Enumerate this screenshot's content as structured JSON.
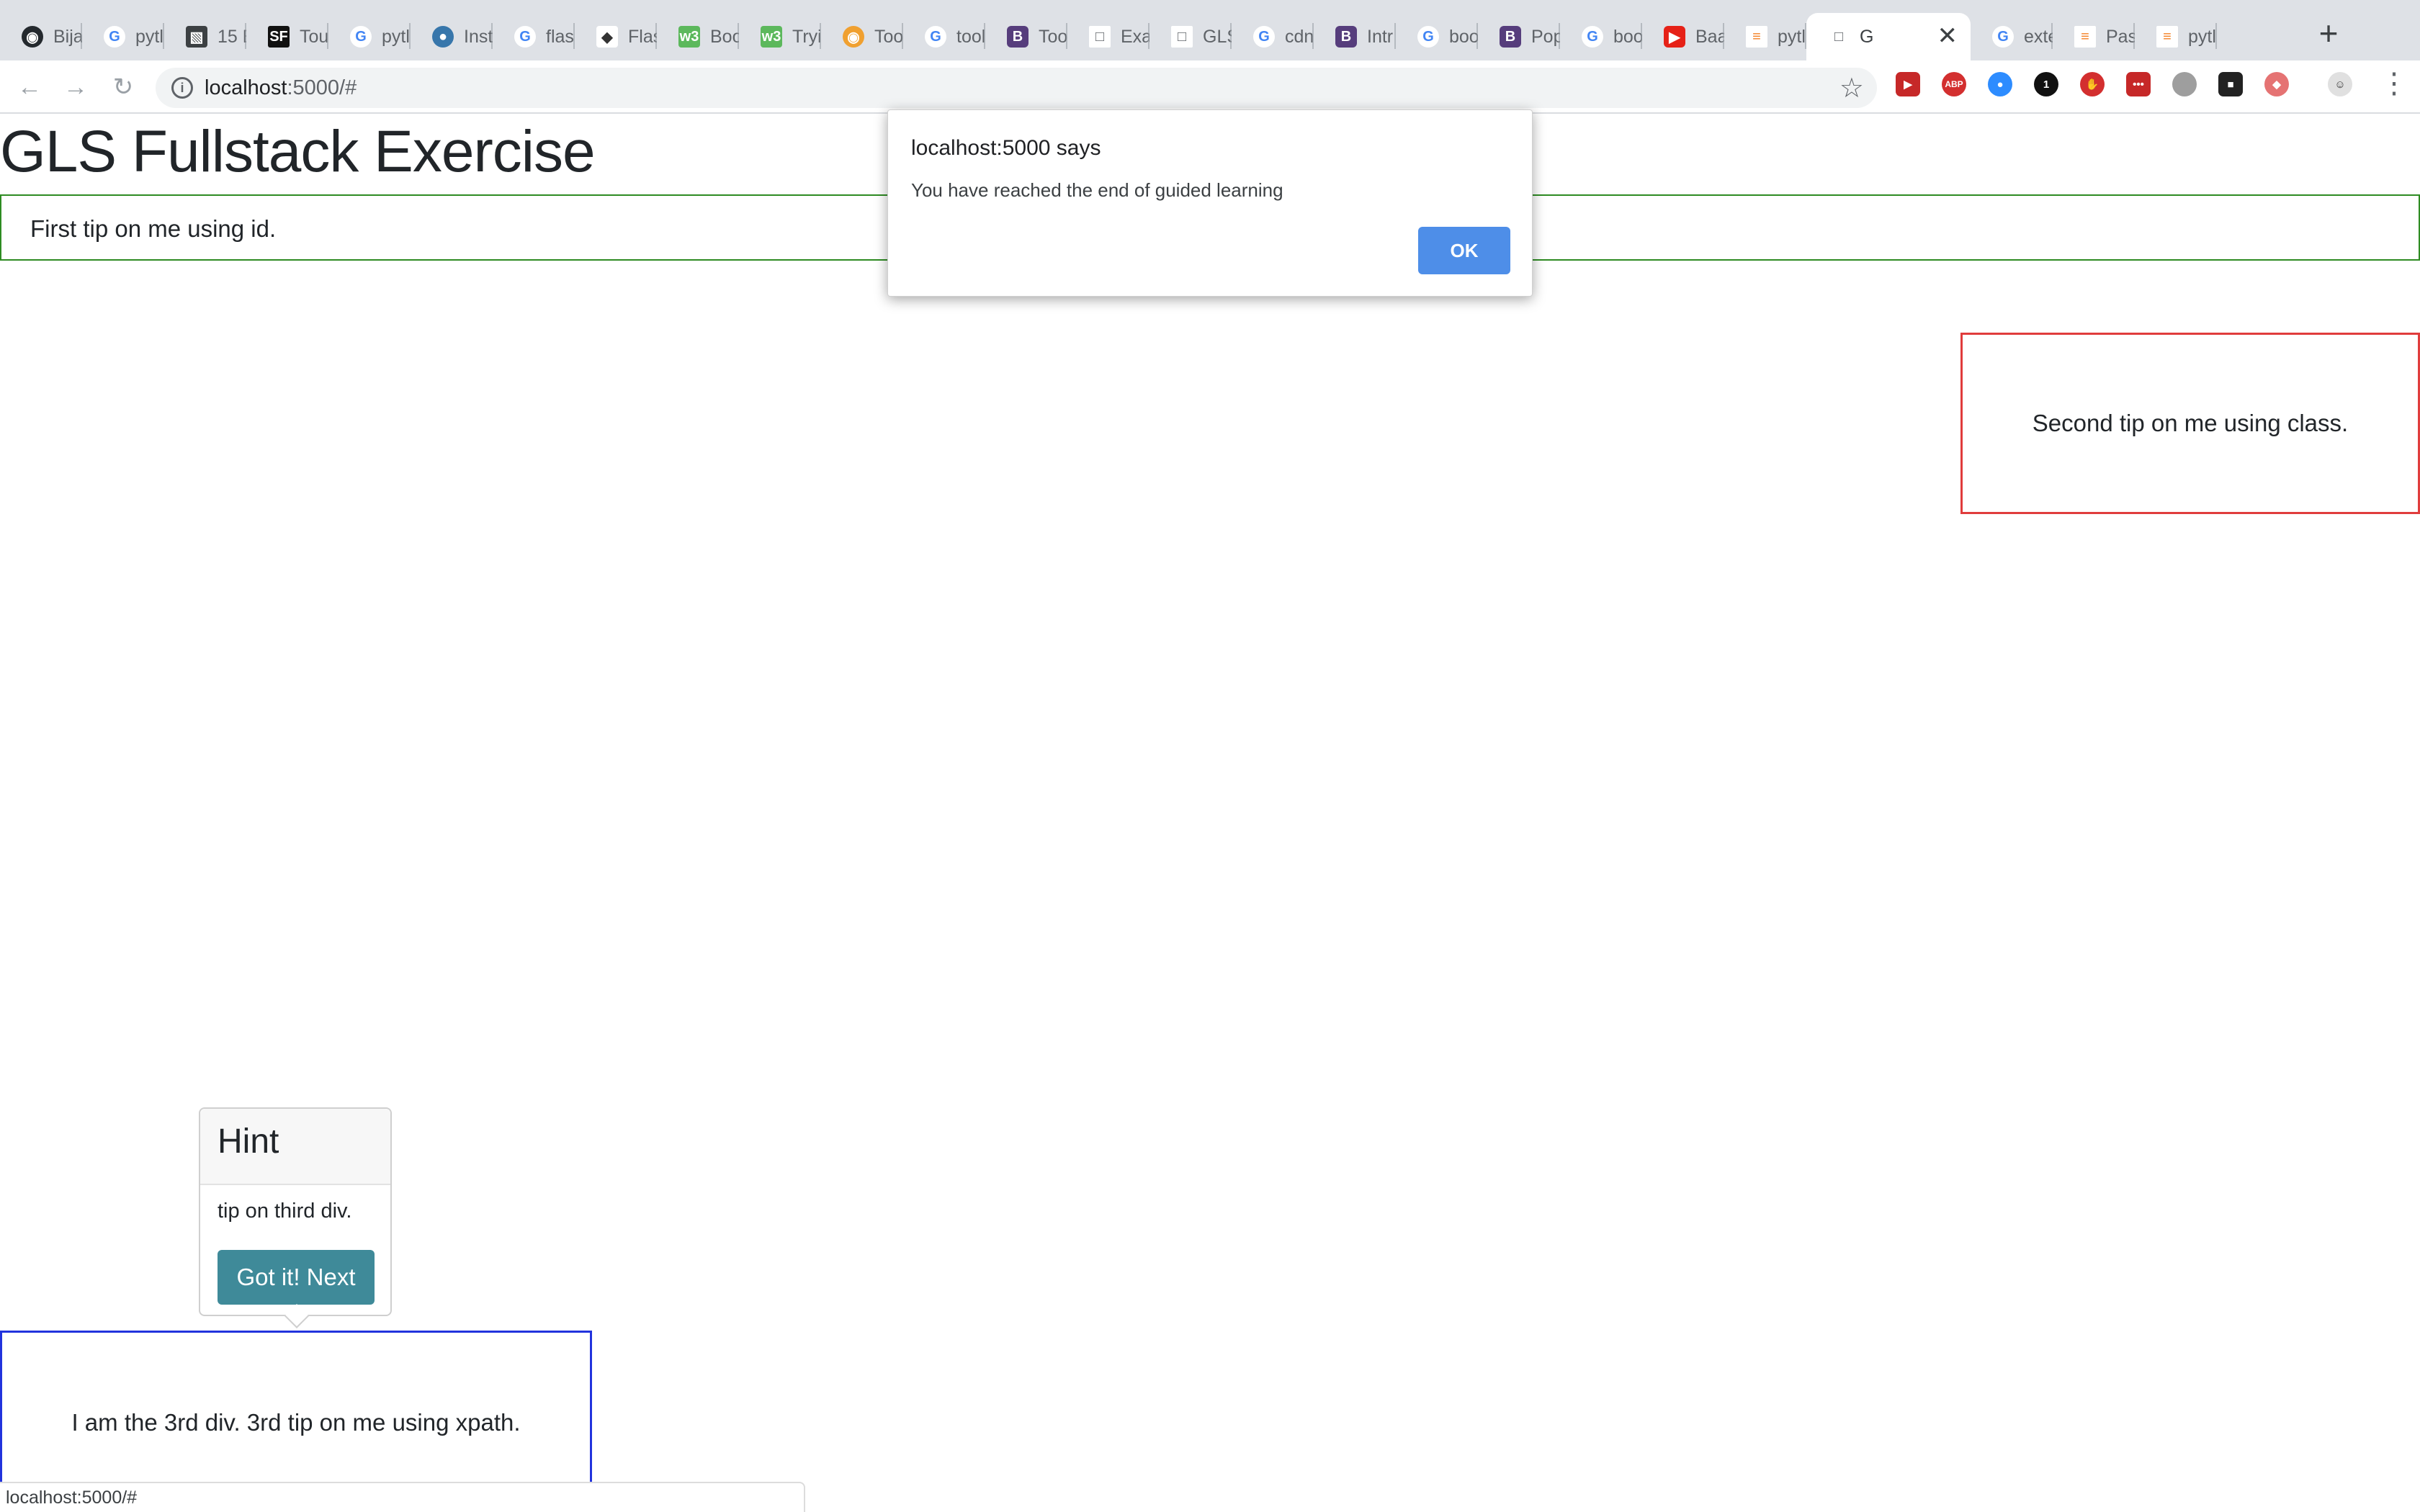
{
  "browser": {
    "tabs": [
      {
        "title": "Bija",
        "icon": "github-icon"
      },
      {
        "title": "pytl",
        "icon": "google-icon"
      },
      {
        "title": "15 E",
        "icon": "card-icon"
      },
      {
        "title": "Tou",
        "icon": "sf-icon"
      },
      {
        "title": "pytl",
        "icon": "google-icon"
      },
      {
        "title": "Inst",
        "icon": "python-icon"
      },
      {
        "title": "flas",
        "icon": "google-icon"
      },
      {
        "title": "Flas",
        "icon": "diamond-icon"
      },
      {
        "title": "Boo",
        "icon": "w3-icon"
      },
      {
        "title": "Tryi",
        "icon": "w3-icon"
      },
      {
        "title": "Too",
        "icon": "fox-icon"
      },
      {
        "title": "tool",
        "icon": "google-icon"
      },
      {
        "title": "Too",
        "icon": "bootstrap-icon"
      },
      {
        "title": "Exa",
        "icon": "document-icon"
      },
      {
        "title": "GLS",
        "icon": "document-icon"
      },
      {
        "title": "cdn",
        "icon": "google-icon"
      },
      {
        "title": "Intr",
        "icon": "bootstrap-icon"
      },
      {
        "title": "boo",
        "icon": "google-icon"
      },
      {
        "title": "Pop",
        "icon": "bootstrap-icon"
      },
      {
        "title": "boo",
        "icon": "google-icon"
      },
      {
        "title": "Baa",
        "icon": "youtube-icon"
      },
      {
        "title": "pytl",
        "icon": "stackoverflow-icon"
      },
      {
        "title": "G",
        "icon": "document-icon"
      },
      {
        "title": "exte",
        "icon": "google-icon"
      },
      {
        "title": "Pas",
        "icon": "stackoverflow-icon"
      },
      {
        "title": "pytl",
        "icon": "stackoverflow-icon"
      }
    ],
    "active_tab_index": 22,
    "url_host": "localhost",
    "url_rest": ":5000/#",
    "status_url": "localhost:5000/#"
  },
  "page": {
    "heading": "GLS Fullstack Exercise",
    "div1_text": "First tip on me using id.",
    "div2_text": "Second tip on me using class.",
    "div3_text": "I am the 3rd div. 3rd tip on me using xpath."
  },
  "popover": {
    "title": "Hint",
    "body": "tip on third div.",
    "button_label": "Got it! Next"
  },
  "alert": {
    "origin": "localhost:5000 says",
    "message": "You have reached the end of guided learning",
    "ok_label": "OK"
  },
  "colors": {
    "div1_border": "#2e8b22",
    "div2_border": "#e03c3c",
    "div3_border": "#2233dd",
    "popover_button": "#3f8a99",
    "alert_ok": "#4e8ee8"
  }
}
